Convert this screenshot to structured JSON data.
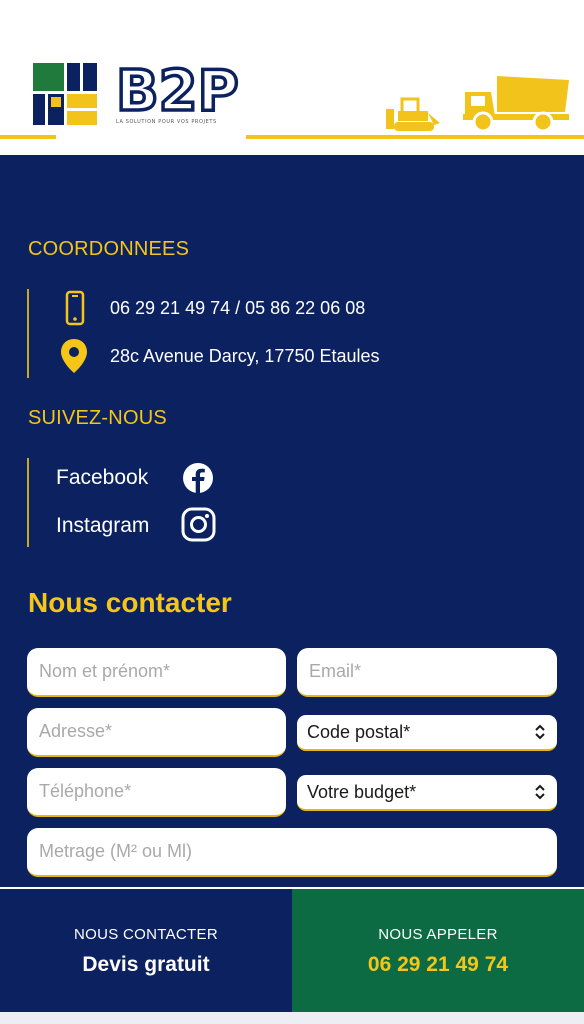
{
  "header": {
    "logo_text": "B2P",
    "tagline": "LA SOLUTION POUR VOS PROJETS",
    "colors": {
      "navy": "#0b2160",
      "yellow": "#f2c31b",
      "green": "#0d6b44"
    }
  },
  "coordonnees": {
    "title": "COORDONNEES",
    "phone": "06 29 21 49 74 / 05 86 22 06 08",
    "address": "28c Avenue Darcy, 17750 Etaules",
    "phone_icon": "mobile-phone-icon",
    "address_icon": "map-pin-icon"
  },
  "social": {
    "title": "SUIVEZ-NOUS",
    "facebook": "Facebook",
    "instagram": "Instagram"
  },
  "form": {
    "heading": "Nous contacter",
    "name_placeholder": "Nom et prénom*",
    "email_placeholder": "Email*",
    "address_placeholder": "Adresse*",
    "postal_selected": "Code postal*",
    "phone_placeholder": "Téléphone*",
    "budget_selected": "Votre budget*",
    "metrage_placeholder": "Metrage (M² ou Ml)"
  },
  "bottom": {
    "contact_small": "NOUS CONTACTER",
    "contact_big": "Devis gratuit",
    "call_small": "NOUS APPELER",
    "call_big": "06 29 21 49 74"
  }
}
